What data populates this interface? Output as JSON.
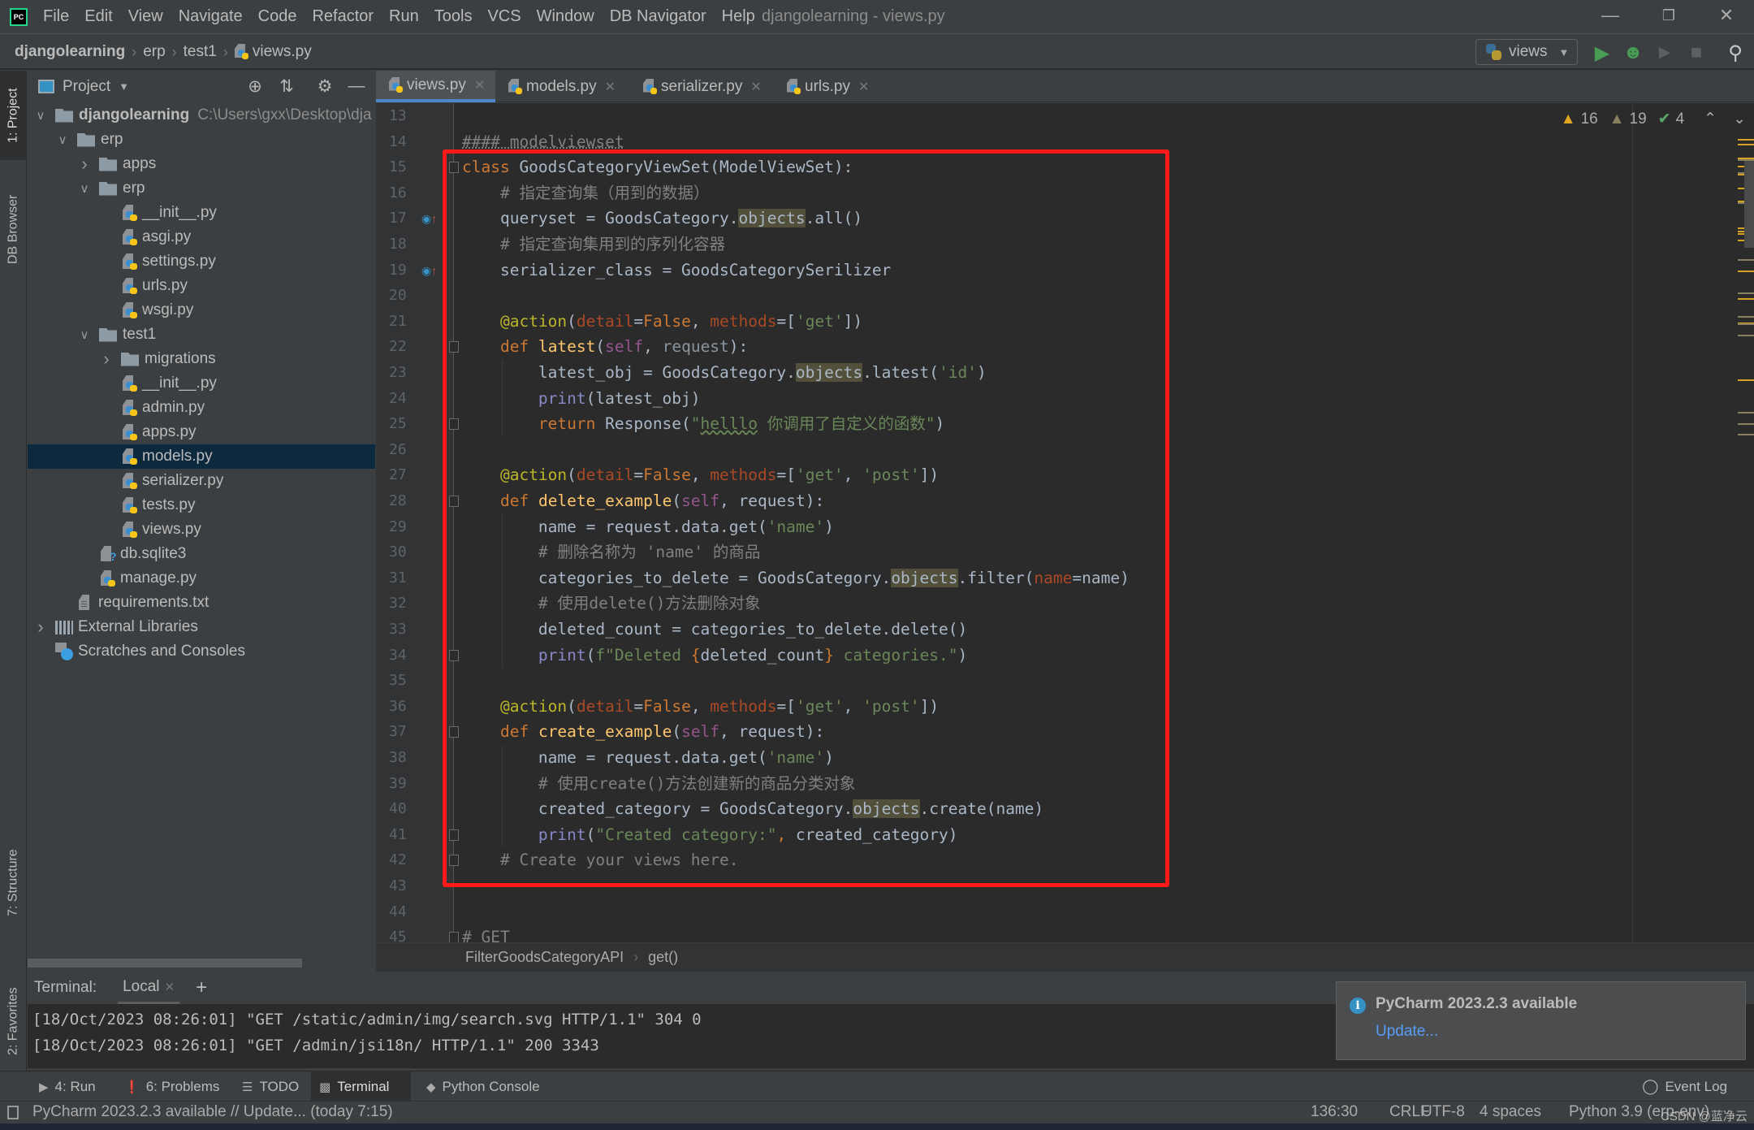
{
  "menu": {
    "items": [
      "File",
      "Edit",
      "View",
      "Navigate",
      "Code",
      "Refactor",
      "Run",
      "Tools",
      "VCS",
      "Window",
      "DB Navigator",
      "Help"
    ],
    "window_title": "djangolearning - views.py"
  },
  "navbar": {
    "crumbs": [
      "djangolearning",
      "erp",
      "test1",
      "views.py"
    ],
    "run_config": "views"
  },
  "left_stripe": {
    "project": "1: Project",
    "db_browser": "DB Browser",
    "structure": "7: Structure",
    "favorites": "2: Favorites"
  },
  "project": {
    "title": "Project",
    "tree": [
      {
        "label": "djangolearning",
        "hint": "C:\\Users\\gxx\\Desktop\\dja",
        "type": "folder",
        "depth": 0,
        "expanded": true,
        "bold": true
      },
      {
        "label": "erp",
        "type": "folder",
        "depth": 1,
        "expanded": true
      },
      {
        "label": "apps",
        "type": "folder",
        "depth": 2,
        "expanded": false
      },
      {
        "label": "erp",
        "type": "folder",
        "depth": 2,
        "expanded": true
      },
      {
        "label": "__init__.py",
        "type": "py",
        "depth": 3
      },
      {
        "label": "asgi.py",
        "type": "py",
        "depth": 3
      },
      {
        "label": "settings.py",
        "type": "py",
        "depth": 3
      },
      {
        "label": "urls.py",
        "type": "py",
        "depth": 3
      },
      {
        "label": "wsgi.py",
        "type": "py",
        "depth": 3
      },
      {
        "label": "test1",
        "type": "folder",
        "depth": 2,
        "expanded": true
      },
      {
        "label": "migrations",
        "type": "folder",
        "depth": 3,
        "expanded": false
      },
      {
        "label": "__init__.py",
        "type": "py",
        "depth": 3
      },
      {
        "label": "admin.py",
        "type": "py",
        "depth": 3
      },
      {
        "label": "apps.py",
        "type": "py",
        "depth": 3
      },
      {
        "label": "models.py",
        "type": "py",
        "depth": 3,
        "selected": true
      },
      {
        "label": "serializer.py",
        "type": "py",
        "depth": 3
      },
      {
        "label": "tests.py",
        "type": "py",
        "depth": 3
      },
      {
        "label": "views.py",
        "type": "py",
        "depth": 3
      },
      {
        "label": "db.sqlite3",
        "type": "unknown",
        "depth": 2
      },
      {
        "label": "manage.py",
        "type": "py",
        "depth": 2
      },
      {
        "label": "requirements.txt",
        "type": "txt",
        "depth": 1
      },
      {
        "label": "External Libraries",
        "type": "lib",
        "depth": 0,
        "expanded": false
      },
      {
        "label": "Scratches and Consoles",
        "type": "scratch",
        "depth": 0
      }
    ]
  },
  "editor": {
    "tabs": [
      {
        "label": "views.py",
        "active": true
      },
      {
        "label": "models.py",
        "active": false
      },
      {
        "label": "serializer.py",
        "active": false
      },
      {
        "label": "urls.py",
        "active": false
      }
    ],
    "inspections": {
      "warnings": "16",
      "weak_warnings": "19",
      "typos": "4"
    },
    "first_line": 13,
    "lines": [
      {
        "n": 13,
        "html": ""
      },
      {
        "n": 14,
        "html": "<span class='cm mdl'>#### modelviewset</span>"
      },
      {
        "n": 15,
        "html": "<span class='kw'>class</span> GoodsCategoryViewSet(ModelViewSet):"
      },
      {
        "n": 16,
        "html": "    <span class='cm'># 指定查询集（用到的数据）</span>"
      },
      {
        "n": 17,
        "html": "    queryset = GoodsCategory.<span class='hl'>objects</span>.all()"
      },
      {
        "n": 18,
        "html": "    <span class='cm'># 指定查询集用到的序列化容器</span>"
      },
      {
        "n": 19,
        "html": "    serializer_class = GoodsCategorySerilizer"
      },
      {
        "n": 20,
        "html": ""
      },
      {
        "n": 21,
        "html": "    <span class='dec'>@action</span>(<span class='param'>detail</span>=<span class='kw'>False</span>, <span class='param'>methods</span>=[<span class='str'>'get'</span>])"
      },
      {
        "n": 22,
        "html": "    <span class='kw'>def</span> <span class='fn'>latest</span>(<span class='self'>self</span>, <span class='gray'>request</span>):"
      },
      {
        "n": 23,
        "html": "        latest_obj = GoodsCategory.<span class='hl'>objects</span>.latest(<span class='str'>'id'</span>)"
      },
      {
        "n": 24,
        "html": "        <span class='bi'>print</span>(latest_obj)"
      },
      {
        "n": 25,
        "html": "        <span class='kw'>return</span> Response(<span class='str'>\"<span class='squig'>helllo</span> 你调用了自定义的函数\"</span>)"
      },
      {
        "n": 26,
        "html": ""
      },
      {
        "n": 27,
        "html": "    <span class='dec'>@action</span>(<span class='param'>detail</span>=<span class='kw'>False</span>, <span class='param'>methods</span>=[<span class='str'>'get'</span>, <span class='str'>'post'</span>])"
      },
      {
        "n": 28,
        "html": "    <span class='kw'>def</span> <span class='fn'>delete_example</span>(<span class='self'>self</span>, request):"
      },
      {
        "n": 29,
        "html": "        name = request.data.get(<span class='str'>'name'</span>)"
      },
      {
        "n": 30,
        "html": "        <span class='cm'># 删除名称为 'name' 的商品</span>"
      },
      {
        "n": 31,
        "html": "        categories_to_delete = GoodsCategory.<span class='hl'>objects</span>.filter(<span class='param'>name</span>=name)"
      },
      {
        "n": 32,
        "html": "        <span class='cm'># 使用delete()方法删除对象</span>"
      },
      {
        "n": 33,
        "html": "        deleted_count = categories_to_delete.delete()"
      },
      {
        "n": 34,
        "html": "        <span class='bi'>print</span>(<span class='str'>f\"Deleted </span><span class='kw'>{</span>deleted_count<span class='kw'>}</span><span class='str'> categories.\"</span>)"
      },
      {
        "n": 35,
        "html": ""
      },
      {
        "n": 36,
        "html": "    <span class='dec'>@action</span>(<span class='param'>detail</span>=<span class='kw'>False</span>, <span class='param'>methods</span>=[<span class='str'>'get'</span>, <span class='str'>'post'</span>])"
      },
      {
        "n": 37,
        "html": "    <span class='kw'>def</span> <span class='fn'>create_example</span>(<span class='self'>self</span>, request):"
      },
      {
        "n": 38,
        "html": "        name = request.data.get(<span class='str'>'name'</span>)"
      },
      {
        "n": 39,
        "html": "        <span class='cm'># 使用create()方法创建新的商品分类对象</span>"
      },
      {
        "n": 40,
        "html": "        created_category = GoodsCategory.<span class='hl'>objects</span>.create(name)"
      },
      {
        "n": 41,
        "html": "        <span class='bi'>print</span>(<span class='str'>\"Created category:\"</span><span class='kw'>,</span> created_category)"
      },
      {
        "n": 42,
        "html": "    <span class='cm'># Create your views here.</span>"
      },
      {
        "n": 43,
        "html": ""
      },
      {
        "n": 44,
        "html": ""
      },
      {
        "n": 45,
        "html": "<span class='cm'># GET</span>"
      }
    ],
    "breadcrumb": [
      "FilterGoodsCategoryAPI",
      "get()"
    ]
  },
  "terminal": {
    "label": "Terminal:",
    "tab": "Local",
    "lines": [
      "[18/Oct/2023 08:26:01] \"GET /static/admin/img/search.svg HTTP/1.1\" 304 0",
      "[18/Oct/2023 08:26:01] \"GET /admin/jsi18n/ HTTP/1.1\" 200 3343"
    ]
  },
  "notification": {
    "title": "PyCharm 2023.2.3 available",
    "link": "Update..."
  },
  "tool_tabs": [
    {
      "label": "4: Run",
      "icon": "play-icon"
    },
    {
      "label": "6: Problems",
      "icon": "problems-icon"
    },
    {
      "label": "TODO",
      "icon": "todo-icon"
    },
    {
      "label": "Terminal",
      "icon": "terminal-icon",
      "active": true
    },
    {
      "label": "Python Console",
      "icon": "python-console-icon"
    }
  ],
  "event_log": "Event Log",
  "status": {
    "message": "PyCharm 2023.2.3 available // Update... (today 7:15)",
    "position": "136:30",
    "line_sep": "CRLF",
    "encoding": "UTF-8",
    "indent": "4 spaces",
    "interpreter": "Python 3.9 (erp-env)",
    "watermark": "CSDN @蓝净云"
  },
  "colors": {
    "accent": "#4a88c7",
    "highlight_box": "#ff1a1a",
    "selection": "#0d293e",
    "link": "#589df6"
  }
}
